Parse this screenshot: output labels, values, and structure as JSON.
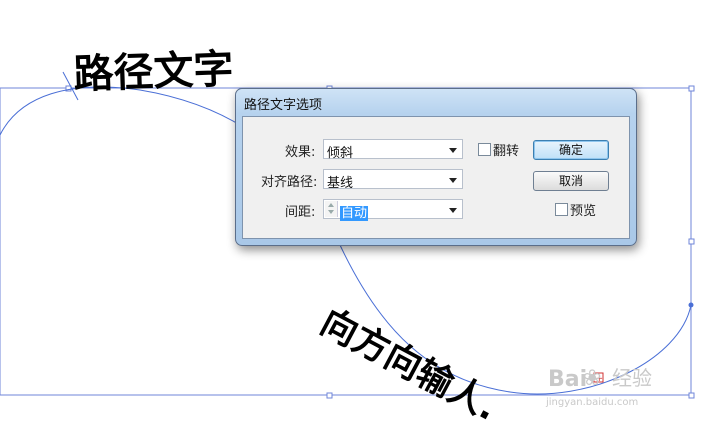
{
  "canvas": {
    "path_text_top": "路径文字",
    "path_text_bottom": "向方向输人.",
    "baidu_watermark_logo": "Bai",
    "baidu_watermark_text": "经验",
    "baidu_watermark_url": "jingyan.baidu.com"
  },
  "dialog": {
    "title": "路径文字选项",
    "effect_label": "效果:",
    "effect_value": "倾斜",
    "align_label": "对齐路径:",
    "align_value": "基线",
    "spacing_label": "间距:",
    "spacing_value": "自动",
    "flip_label": "翻转",
    "flip_checked": false,
    "ok_label": "确定",
    "cancel_label": "取消",
    "preview_label": "预览",
    "preview_checked": false
  },
  "colors": {
    "path_stroke": "#4a6fd6",
    "selection_box": "#6f86d8",
    "accent": "#3399ff"
  }
}
